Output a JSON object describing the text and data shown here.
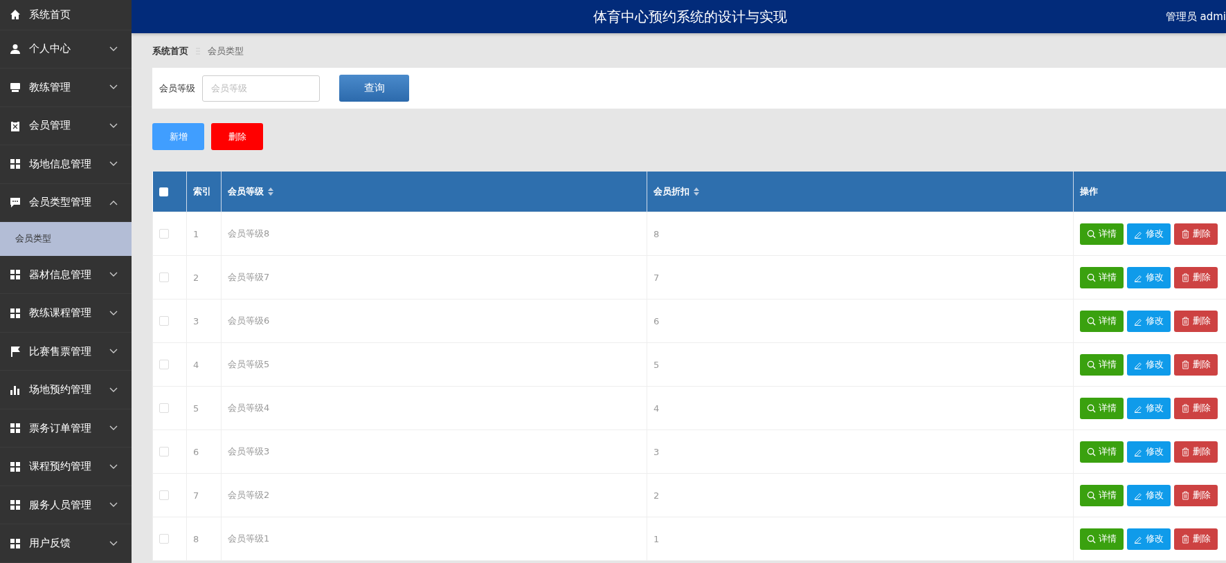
{
  "header": {
    "title": "体育中心预约系统的设计与实现",
    "user": "管理员 admi"
  },
  "sidebar": {
    "items": [
      {
        "label": "系统首页",
        "kind": "link"
      },
      {
        "label": "个人中心",
        "kind": "menu",
        "expanded": false
      },
      {
        "label": "教练管理",
        "kind": "menu",
        "expanded": false
      },
      {
        "label": "会员管理",
        "kind": "menu",
        "expanded": false
      },
      {
        "label": "场地信息管理",
        "kind": "menu",
        "expanded": false
      },
      {
        "label": "会员类型管理",
        "kind": "menu",
        "expanded": true,
        "children": [
          {
            "label": "会员类型",
            "selected": true
          }
        ]
      },
      {
        "label": "器材信息管理",
        "kind": "menu",
        "expanded": false
      },
      {
        "label": "教练课程管理",
        "kind": "menu",
        "expanded": false
      },
      {
        "label": "比赛售票管理",
        "kind": "menu",
        "expanded": false
      },
      {
        "label": "场地预约管理",
        "kind": "menu",
        "expanded": false
      },
      {
        "label": "票务订单管理",
        "kind": "menu",
        "expanded": false
      },
      {
        "label": "课程预约管理",
        "kind": "menu",
        "expanded": false
      },
      {
        "label": "服务人员管理",
        "kind": "menu",
        "expanded": false
      },
      {
        "label": "用户反馈",
        "kind": "menu",
        "expanded": false
      }
    ]
  },
  "breadcrumb": [
    {
      "label": "系统首页"
    },
    {
      "label": "会员类型"
    }
  ],
  "search": {
    "label": "会员等级",
    "placeholder": "会员等级",
    "button": "查询"
  },
  "toolbar": [
    {
      "kind": "add",
      "label": "新增"
    },
    {
      "kind": "delete",
      "label": "删除"
    }
  ],
  "table": {
    "header_checked": false,
    "columns": [
      {
        "label": "索引",
        "sortable": false
      },
      {
        "label": "会员等级",
        "sortable": true
      },
      {
        "label": "会员折扣",
        "sortable": true
      },
      {
        "label": "操作",
        "sortable": false
      }
    ],
    "rows": [
      {
        "checked": false,
        "cells": [
          "1",
          "会员等级8",
          "8"
        ],
        "actions": [
          {
            "kind": "detail",
            "label": "详情"
          },
          {
            "kind": "edit",
            "label": "修改"
          },
          {
            "kind": "delete",
            "label": "删除"
          }
        ]
      },
      {
        "checked": false,
        "cells": [
          "2",
          "会员等级7",
          "7"
        ],
        "actions": [
          {
            "kind": "detail",
            "label": "详情"
          },
          {
            "kind": "edit",
            "label": "修改"
          },
          {
            "kind": "delete",
            "label": "删除"
          }
        ]
      },
      {
        "checked": false,
        "cells": [
          "3",
          "会员等级6",
          "6"
        ],
        "actions": [
          {
            "kind": "detail",
            "label": "详情"
          },
          {
            "kind": "edit",
            "label": "修改"
          },
          {
            "kind": "delete",
            "label": "删除"
          }
        ]
      },
      {
        "checked": false,
        "cells": [
          "4",
          "会员等级5",
          "5"
        ],
        "actions": [
          {
            "kind": "detail",
            "label": "详情"
          },
          {
            "kind": "edit",
            "label": "修改"
          },
          {
            "kind": "delete",
            "label": "删除"
          }
        ]
      },
      {
        "checked": false,
        "cells": [
          "5",
          "会员等级4",
          "4"
        ],
        "actions": [
          {
            "kind": "detail",
            "label": "详情"
          },
          {
            "kind": "edit",
            "label": "修改"
          },
          {
            "kind": "delete",
            "label": "删除"
          }
        ]
      },
      {
        "checked": false,
        "cells": [
          "6",
          "会员等级3",
          "3"
        ],
        "actions": [
          {
            "kind": "detail",
            "label": "详情"
          },
          {
            "kind": "edit",
            "label": "修改"
          },
          {
            "kind": "delete",
            "label": "删除"
          }
        ]
      },
      {
        "checked": false,
        "cells": [
          "7",
          "会员等级2",
          "2"
        ],
        "actions": [
          {
            "kind": "detail",
            "label": "详情"
          },
          {
            "kind": "edit",
            "label": "修改"
          },
          {
            "kind": "delete",
            "label": "删除"
          }
        ]
      },
      {
        "checked": false,
        "cells": [
          "8",
          "会员等级1",
          "1"
        ],
        "actions": [
          {
            "kind": "detail",
            "label": "详情"
          },
          {
            "kind": "edit",
            "label": "修改"
          },
          {
            "kind": "delete",
            "label": "删除"
          }
        ]
      }
    ]
  }
}
